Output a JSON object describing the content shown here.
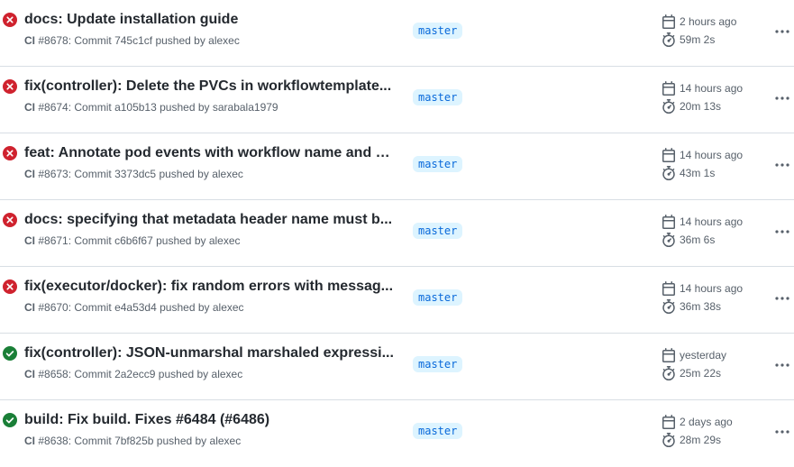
{
  "runs": [
    {
      "status": "failure",
      "title": "docs: Update installation guide",
      "workflow": "CI",
      "run": "#8678",
      "commit_prefix": ": Commit",
      "sha": "745c1cf",
      "pushed": "pushed by",
      "author": "alexec",
      "branch": "master",
      "when": "2 hours ago",
      "duration": "59m 2s"
    },
    {
      "status": "failure",
      "title": "fix(controller): Delete the PVCs in workflowtemplate...",
      "workflow": "CI",
      "run": "#8674",
      "commit_prefix": ": Commit",
      "sha": "a105b13",
      "pushed": "pushed by",
      "author": "sarabala1979",
      "branch": "master",
      "when": "14 hours ago",
      "duration": "20m 13s"
    },
    {
      "status": "failure",
      "title": "feat: Annotate pod events with workflow name and U...",
      "workflow": "CI",
      "run": "#8673",
      "commit_prefix": ": Commit",
      "sha": "3373dc5",
      "pushed": "pushed by",
      "author": "alexec",
      "branch": "master",
      "when": "14 hours ago",
      "duration": "43m 1s"
    },
    {
      "status": "failure",
      "title": "docs: specifying that metadata header name must b...",
      "workflow": "CI",
      "run": "#8671",
      "commit_prefix": ": Commit",
      "sha": "c6b6f67",
      "pushed": "pushed by",
      "author": "alexec",
      "branch": "master",
      "when": "14 hours ago",
      "duration": "36m 6s"
    },
    {
      "status": "failure",
      "title": "fix(executor/docker): fix random errors with messag...",
      "workflow": "CI",
      "run": "#8670",
      "commit_prefix": ": Commit",
      "sha": "e4a53d4",
      "pushed": "pushed by",
      "author": "alexec",
      "branch": "master",
      "when": "14 hours ago",
      "duration": "36m 38s"
    },
    {
      "status": "success",
      "title": "fix(controller): JSON-unmarshal marshaled expressi...",
      "workflow": "CI",
      "run": "#8658",
      "commit_prefix": ": Commit",
      "sha": "2a2ecc9",
      "pushed": "pushed by",
      "author": "alexec",
      "branch": "master",
      "when": "yesterday",
      "duration": "25m 22s"
    },
    {
      "status": "success",
      "title": "build: Fix build. Fixes #6484 (#6486)",
      "workflow": "CI",
      "run": "#8638",
      "commit_prefix": ": Commit",
      "sha": "7bf825b",
      "pushed": "pushed by",
      "author": "alexec",
      "branch": "master",
      "when": "2 days ago",
      "duration": "28m 29s"
    }
  ],
  "icons": {
    "status_failure": "x-circle-fill-icon",
    "status_success": "check-circle-fill-icon",
    "calendar": "calendar-icon",
    "stopwatch": "stopwatch-icon",
    "more": "kebab-horizontal-icon"
  },
  "colors": {
    "failure": "#cf222e",
    "success": "#1a7f37",
    "branch_text": "#0969da",
    "branch_bg": "#ddf4ff",
    "muted": "#57606a"
  }
}
